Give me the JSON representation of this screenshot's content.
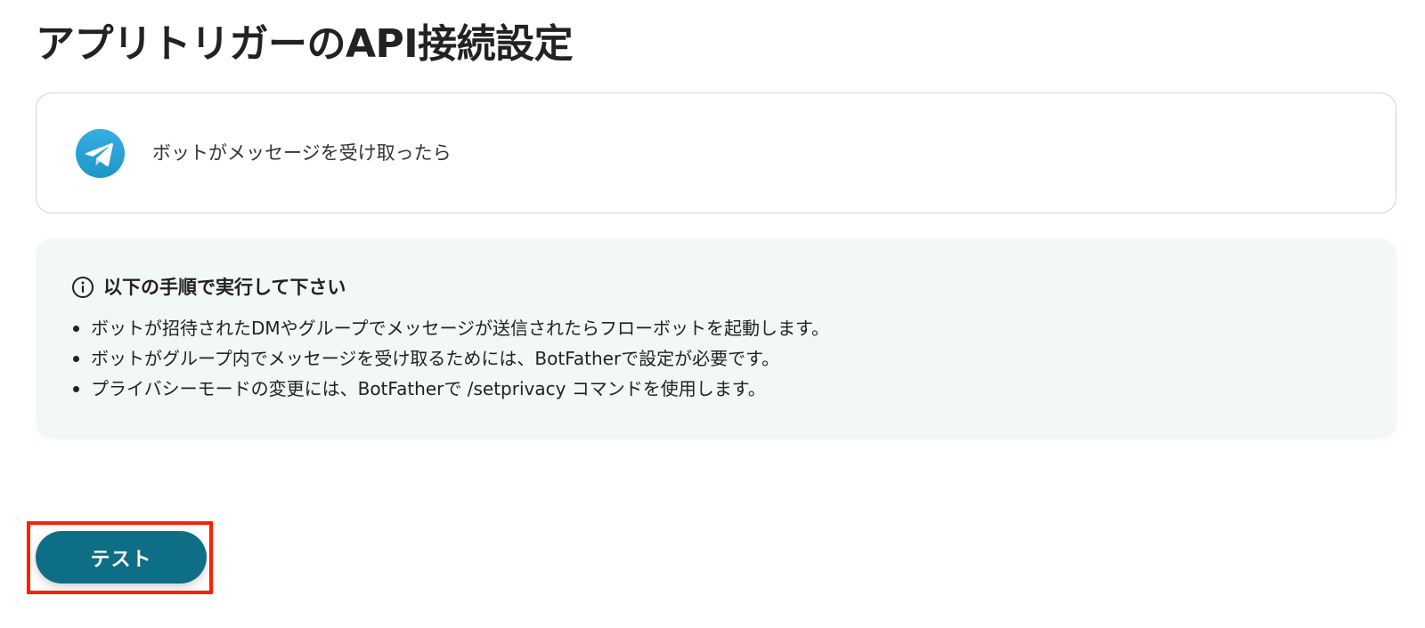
{
  "page": {
    "title": "アプリトリガーのAPI接続設定"
  },
  "trigger_card": {
    "icon": "telegram-icon",
    "label": "ボットがメッセージを受け取ったら"
  },
  "instructions": {
    "icon": "info-circle-icon",
    "title": "以下の手順で実行して下さい",
    "items": [
      "ボットが招待されたDMやグループでメッセージが送信されたらフローボットを起動します。",
      "ボットがグループ内でメッセージを受け取るためには、BotFatherで設定が必要です。",
      "プライバシーモードの変更には、BotFatherで /setprivacy コマンドを使用します。"
    ]
  },
  "actions": {
    "test_label": "テスト"
  },
  "colors": {
    "button_bg": "#0e6e85",
    "highlight_border": "#ff1f00",
    "instructions_bg": "#f2f7f7",
    "telegram_blue": "#2aa3df"
  }
}
